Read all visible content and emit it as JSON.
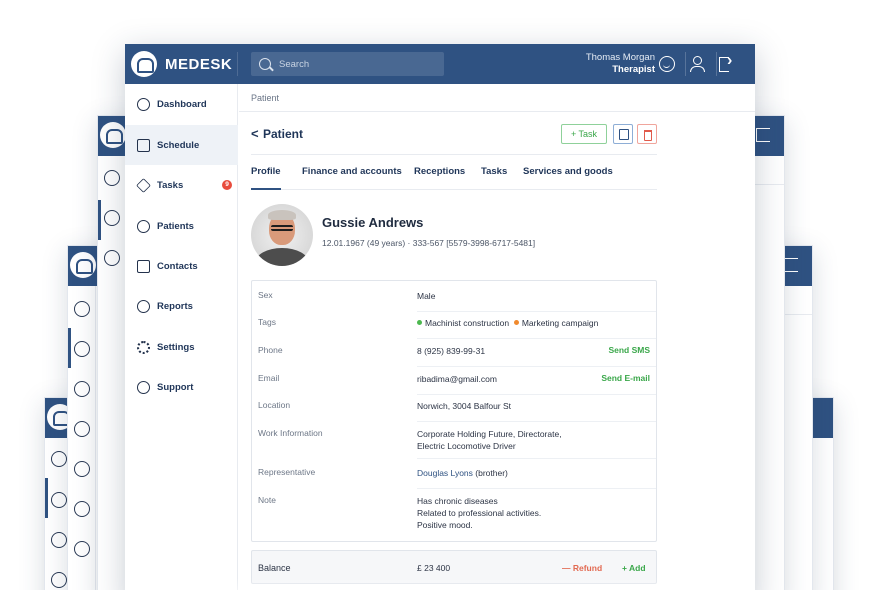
{
  "app": {
    "brand": "MEDESK"
  },
  "topbar": {
    "search_placeholder": "Search",
    "user_name": "Thomas Morgan",
    "user_role": "Therapist"
  },
  "sidebar": {
    "items": [
      {
        "label": "Dashboard",
        "icon": "dashboard-icon"
      },
      {
        "label": "Schedule",
        "icon": "calendar-icon",
        "active": true
      },
      {
        "label": "Tasks",
        "icon": "layers-icon",
        "badge": "9"
      },
      {
        "label": "Patients",
        "icon": "users-icon"
      },
      {
        "label": "Contacts",
        "icon": "building-icon"
      },
      {
        "label": "Reports",
        "icon": "pie-chart-icon"
      },
      {
        "label": "Settings",
        "icon": "gear-icon"
      },
      {
        "label": "Support",
        "icon": "lifebuoy-icon"
      }
    ]
  },
  "breadcrumb": "Patient",
  "page": {
    "title": "Patient",
    "back_symbol": "<",
    "task_button": "+ Task"
  },
  "tabs": [
    "Profile",
    "Finance and accounts",
    "Receptions",
    "Tasks",
    "Services and goods"
  ],
  "patient": {
    "name": "Gussie Andrews",
    "meta": "12.01.1967 (49 years)  ·  333-567 [5579-3998-6717-5481]"
  },
  "details": {
    "sex": {
      "label": "Sex",
      "value": "Male"
    },
    "tags": {
      "label": "Tags",
      "items": [
        {
          "text": "Machinist construction",
          "color": "#4cb84f"
        },
        {
          "text": "Marketing campaign",
          "color": "#f08a2e"
        }
      ]
    },
    "phone": {
      "label": "Phone",
      "value": "8 (925) 839-99-31",
      "action": "Send SMS"
    },
    "email": {
      "label": "Email",
      "value": "ribadima@gmail.com",
      "action": "Send E-mail"
    },
    "location": {
      "label": "Location",
      "value": "Norwich, 3004 Balfour St"
    },
    "work": {
      "label": "Work Information",
      "line1": "Corporate Holding Future, Directorate,",
      "line2": "Electric Locomotive Driver"
    },
    "representative": {
      "label": "Representative",
      "name": "Douglas Lyons",
      "relation": " (brother)"
    },
    "note": {
      "label": "Note",
      "line1": "Has chronic diseases",
      "line2": "Related to professional activities.",
      "line3": "Positive mood."
    }
  },
  "balance": {
    "label": "Balance",
    "value": "£ 23 400",
    "refund": "— Refund",
    "add": "+ Add"
  },
  "colors": {
    "topbar": "#2f5282",
    "accent_green": "#3aa74a",
    "accent_red": "#e15a4b"
  }
}
